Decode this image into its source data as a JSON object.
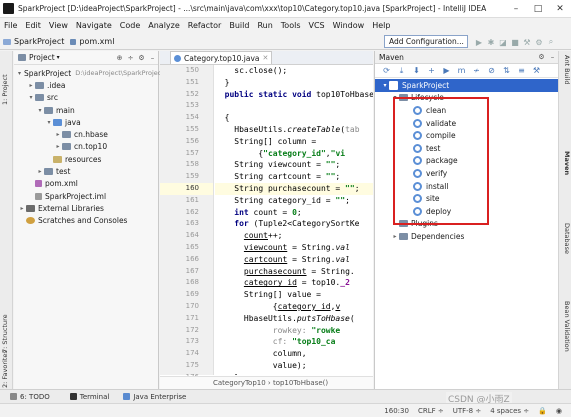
{
  "title_bar": {
    "text": "SparkProject [D:\\ideaProject\\SparkProject] - ...\\src\\main\\java\\com\\xxx\\top10\\Category.top10.java [SparkProject] - IntelliJ IDEA",
    "minimize": "–",
    "maximize": "□",
    "close": "✕"
  },
  "menu": [
    "File",
    "Edit",
    "View",
    "Navigate",
    "Code",
    "Analyze",
    "Refactor",
    "Build",
    "Run",
    "Tools",
    "VCS",
    "Window",
    "Help"
  ],
  "nav": {
    "project": "SparkProject",
    "file": "pom.xml"
  },
  "run_config": {
    "label": "Add Configuration..."
  },
  "project_panel": {
    "title": "Project",
    "tree": [
      {
        "indent": 0,
        "arrow": "▾",
        "icon": "folder",
        "label": "SparkProject",
        "suffix": "D:\\ideaProject\\SparkProject"
      },
      {
        "indent": 1,
        "arrow": "▸",
        "icon": "folder",
        "label": ".idea"
      },
      {
        "indent": 1,
        "arrow": "▾",
        "icon": "folder",
        "label": "src"
      },
      {
        "indent": 2,
        "arrow": "▾",
        "icon": "folder",
        "label": "main"
      },
      {
        "indent": 3,
        "arrow": "▾",
        "icon": "folder-blue",
        "label": "java"
      },
      {
        "indent": 4,
        "arrow": "▸",
        "icon": "folder",
        "label": "cn.hbase"
      },
      {
        "indent": 4,
        "arrow": "▸",
        "icon": "folder",
        "label": "cn.top10"
      },
      {
        "indent": 3,
        "arrow": "",
        "icon": "folder-y",
        "label": "resources"
      },
      {
        "indent": 2,
        "arrow": "▸",
        "icon": "folder",
        "label": "test"
      },
      {
        "indent": 1,
        "arrow": "",
        "icon": "file-m",
        "label": "pom.xml"
      },
      {
        "indent": 1,
        "arrow": "",
        "icon": "file",
        "label": "SparkProject.iml"
      },
      {
        "indent": 0,
        "arrow": "▸",
        "icon": "lib",
        "label": "External Libraries"
      },
      {
        "indent": 0,
        "arrow": "",
        "icon": "scratch",
        "label": "Scratches and Consoles"
      }
    ]
  },
  "editor": {
    "tab": "Category.top10.java",
    "current_line": 160,
    "lines": [
      {
        "num": "150",
        "html": "    sc.close();"
      },
      {
        "num": "151",
        "html": "  }"
      },
      {
        "num": "152",
        "html": "  <span class='kw'>public static void</span> top10ToHbase"
      },
      {
        "num": "153",
        "html": ""
      },
      {
        "num": "154",
        "html": "  {"
      },
      {
        "num": "155",
        "html": "    HbaseUtils.<span class='it'>createTable</span>(<span class='grayt'>tab</span>"
      },
      {
        "num": "156",
        "html": "    String[] column ="
      },
      {
        "num": "157",
        "html": "         {<span class='str'>\"category_id\"</span>,<span class='str'>\"vi</span>"
      },
      {
        "num": "158",
        "html": "    String viewcount = <span class='str'>\"\"</span>;"
      },
      {
        "num": "159",
        "html": "    String cartcount = <span class='str'>\"\"</span>;"
      },
      {
        "num": "160",
        "html": "    String purchasecount = <span class='str'>\"\"</span>;"
      },
      {
        "num": "161",
        "html": "    String category_id = <span class='str'>\"\"</span>;"
      },
      {
        "num": "162",
        "html": "    <span class='kw'>int</span> count = <span class='str'>0</span>;"
      },
      {
        "num": "163",
        "html": "    <span class='kw'>for</span> (Tuple2&lt;CategorySortKe"
      },
      {
        "num": "164",
        "html": "      <u>count</u>++;"
      },
      {
        "num": "165",
        "html": "      <u>viewcount</u> = String.<span class='it'>val</span>"
      },
      {
        "num": "166",
        "html": "      <u>cartcount</u> = String.<span class='it'>val</span>"
      },
      {
        "num": "167",
        "html": "      <u>purchasecount</u> = String."
      },
      {
        "num": "168",
        "html": "      <u>category_id</u> = top10.<span class='pur'>_2</span>"
      },
      {
        "num": "169",
        "html": "      String[] value ="
      },
      {
        "num": "170",
        "html": "            {<u>category_id</u>,<u>v</u>"
      },
      {
        "num": "171",
        "html": "      HbaseUtils.<span class='it'>putsToHbase</span>("
      },
      {
        "num": "172",
        "html": "            <span class='grayt'>rowkey:</span> <span class='str'>\"rowke</span>"
      },
      {
        "num": "173",
        "html": "            <span class='grayt'>cf:</span> <span class='str'>\"top10_ca</span>"
      },
      {
        "num": "174",
        "html": "            column,"
      },
      {
        "num": "175",
        "html": "            value);"
      },
      {
        "num": "176",
        "html": "    }"
      },
      {
        "num": "177",
        "html": "  }"
      }
    ],
    "breadcrumb": "CategoryTop10   ›   top10ToHbase()"
  },
  "maven_panel": {
    "title": "Maven",
    "root": "SparkProject",
    "lifecycle": {
      "label": "Lifecycle",
      "goals": [
        "clean",
        "validate",
        "compile",
        "test",
        "package",
        "verify",
        "install",
        "site",
        "deploy"
      ]
    },
    "plugins": "Plugins",
    "dependencies": "Dependencies"
  },
  "left_strip": {
    "project": "1: Project",
    "structure": "7: Structure",
    "favorites": "2: Favorites"
  },
  "right_strip": {
    "ant": "Ant Build",
    "maven": "Maven",
    "database": "Database",
    "bean": "Bean Validation"
  },
  "bottom_tabs": [
    "6: TODO",
    "Terminal",
    "Java Enterprise"
  ],
  "status": {
    "position": "160:30",
    "line_sep": "CRLF ÷",
    "encoding": "UTF-8 ÷",
    "indent": "4 spaces ÷"
  },
  "watermark": "CSDN @小雨Z",
  "colors": {
    "selection": "#2f65ca",
    "highlight_border": "#d92020"
  }
}
